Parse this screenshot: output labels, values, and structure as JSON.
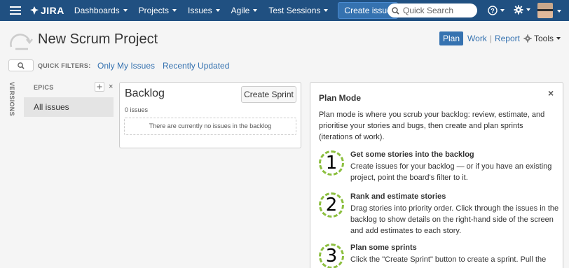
{
  "nav": {
    "logo_text": "JIRA",
    "items": [
      "Dashboards",
      "Projects",
      "Issues",
      "Agile",
      "Test Sessions"
    ],
    "create_label": "Create issue",
    "search_placeholder": "Quick Search"
  },
  "header": {
    "title": "New Scrum Project",
    "modes": {
      "plan": "Plan",
      "work": "Work",
      "report": "Report"
    },
    "tools_label": "Tools"
  },
  "filters": {
    "label": "QUICK FILTERS:",
    "items": [
      "Only My Issues",
      "Recently Updated"
    ]
  },
  "sidebar": {
    "versions_label": "VERSIONS",
    "epics_label": "EPICS",
    "close": "×",
    "all_issues": "All issues"
  },
  "backlog": {
    "title": "Backlog",
    "create_sprint": "Create Sprint",
    "count": "0 issues",
    "empty": "There are currently no issues in the backlog"
  },
  "plan_mode": {
    "title": "Plan Mode",
    "close": "×",
    "description": "Plan mode is where you scrub your backlog: review, estimate, and prioritise your stories and bugs, then create and plan sprints (iterations of work).",
    "steps": [
      {
        "num": "1",
        "title": "Get some stories into the backlog",
        "text": "Create issues for your backlog — or if you have an existing project, point the board's filter to it."
      },
      {
        "num": "2",
        "title": "Rank and estimate stories",
        "text": "Drag stories into priority order. Click through the issues in the backlog to show details on the right-hand side of the screen and add estimates to each story."
      },
      {
        "num": "3",
        "title": "Plan some sprints",
        "text": "Click the \"Create Sprint\" button to create a sprint. Pull the"
      }
    ]
  }
}
